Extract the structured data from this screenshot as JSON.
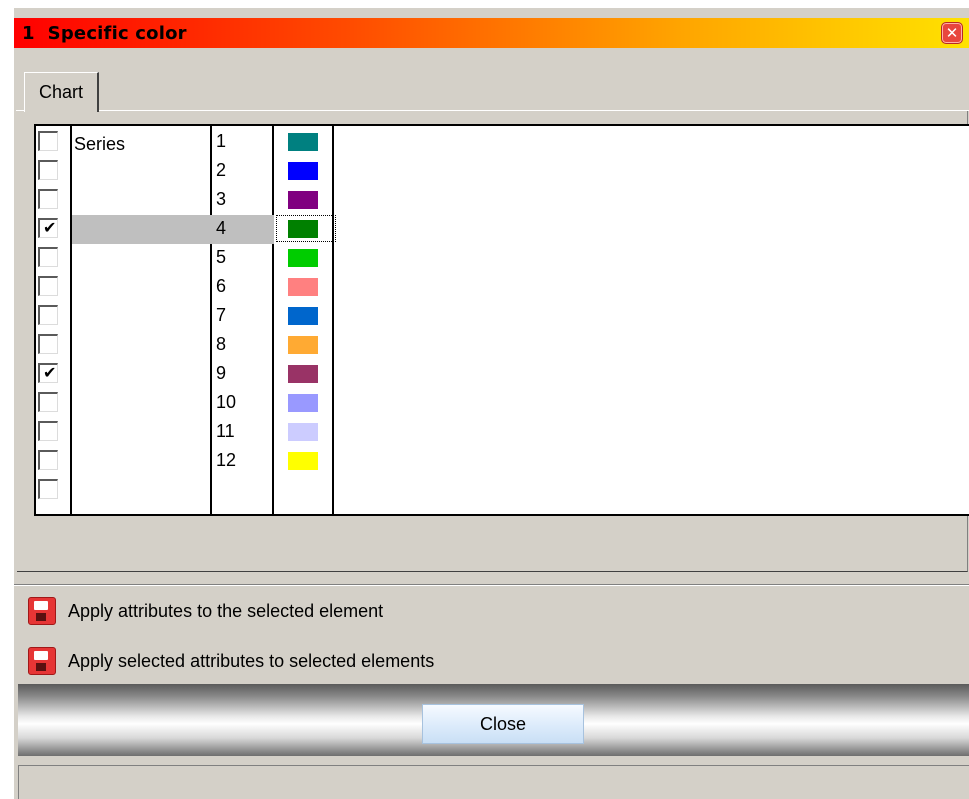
{
  "window": {
    "title": "1  Specific color",
    "close_glyph": "✕"
  },
  "tabs": [
    {
      "label": "Chart"
    }
  ],
  "grid": {
    "column_header": "Series",
    "rows": [
      {
        "checked": false,
        "label": "1",
        "color": "#008080"
      },
      {
        "checked": false,
        "label": "2",
        "color": "#0000ff"
      },
      {
        "checked": false,
        "label": "3",
        "color": "#800080"
      },
      {
        "checked": true,
        "label": "4",
        "color": "#008000",
        "selected": true
      },
      {
        "checked": false,
        "label": "5",
        "color": "#00cc00"
      },
      {
        "checked": false,
        "label": "6",
        "color": "#ff8080"
      },
      {
        "checked": false,
        "label": "7",
        "color": "#0066cc"
      },
      {
        "checked": false,
        "label": "8",
        "color": "#ffaa33"
      },
      {
        "checked": true,
        "label": "9",
        "color": "#993366"
      },
      {
        "checked": false,
        "label": "10",
        "color": "#9999ff"
      },
      {
        "checked": false,
        "label": "11",
        "color": "#ccccff"
      },
      {
        "checked": false,
        "label": "12",
        "color": "#ffff00"
      },
      {
        "checked": false,
        "label": "",
        "color": ""
      }
    ]
  },
  "actions": {
    "apply_selected_element": "Apply attributes to the selected element",
    "apply_selected_attributes": "Apply selected attributes to selected elements"
  },
  "buttons": {
    "close": "Close"
  },
  "icons": {
    "save": "save-icon",
    "check": "checkmark-icon",
    "window_close": "close-icon"
  }
}
